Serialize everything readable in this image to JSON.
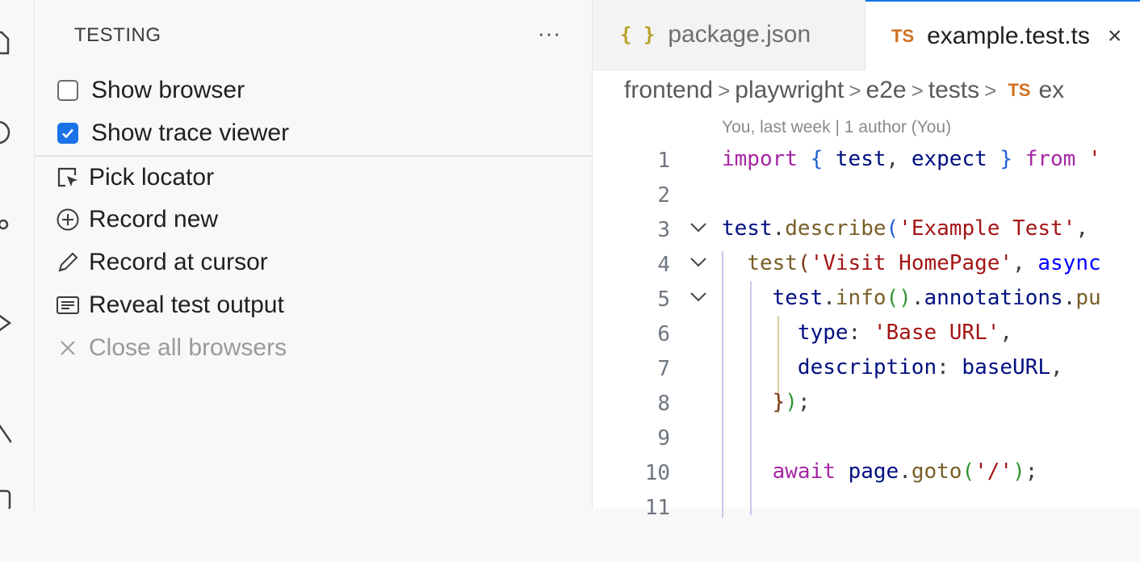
{
  "sidebar": {
    "title": "TESTING",
    "more": "···",
    "settings": [
      {
        "label": "Show browser",
        "checked": false
      },
      {
        "label": "Show trace viewer",
        "checked": true
      }
    ],
    "actions": [
      {
        "label": "Pick locator",
        "icon": "pick-locator-icon"
      },
      {
        "label": "Record new",
        "icon": "plus-circle-icon"
      },
      {
        "label": "Record at cursor",
        "icon": "pencil-icon"
      },
      {
        "label": "Reveal test output",
        "icon": "output-icon"
      },
      {
        "label": "Close all browsers",
        "icon": "close-icon",
        "disabled": true
      }
    ]
  },
  "editor": {
    "tabs": [
      {
        "label": "package.json",
        "icon": "{ }"
      },
      {
        "label": "example.test.ts",
        "icon": "TS",
        "close": "×"
      }
    ],
    "breadcrumb": [
      "frontend",
      "playwright",
      "e2e",
      "tests",
      "ex"
    ],
    "breadcrumb_ts": "TS",
    "blame": "You, last week | 1 author (You)",
    "line_numbers": [
      "1",
      "2",
      "3",
      "4",
      "5",
      "6",
      "7",
      "8",
      "9",
      "10",
      "11"
    ]
  },
  "colors": {
    "accent": "#1a73e8",
    "ts": "#d0701e",
    "json": "#b8a22a"
  }
}
